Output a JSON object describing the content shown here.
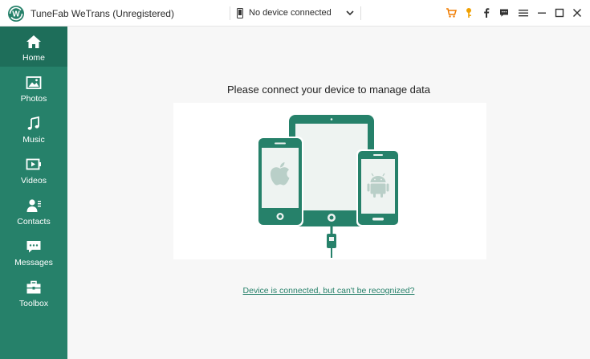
{
  "app": {
    "title": "TuneFab WeTrans (Unregistered)",
    "logo_letter": "W"
  },
  "device_select": {
    "value": "No device connected"
  },
  "toolbar_icons": [
    "cart-icon",
    "key-icon",
    "facebook-icon",
    "feedback-icon",
    "menu-icon",
    "minimize-icon",
    "maximize-icon",
    "close-icon"
  ],
  "sidebar": {
    "items": [
      {
        "label": "Home",
        "icon": "home-icon",
        "active": true
      },
      {
        "label": "Photos",
        "icon": "photos-icon"
      },
      {
        "label": "Music",
        "icon": "music-icon"
      },
      {
        "label": "Videos",
        "icon": "videos-icon"
      },
      {
        "label": "Contacts",
        "icon": "contacts-icon"
      },
      {
        "label": "Messages",
        "icon": "messages-icon"
      },
      {
        "label": "Toolbox",
        "icon": "toolbox-icon"
      }
    ]
  },
  "main": {
    "headline": "Please connect your device to manage data",
    "help_link": "Device is connected, but can't be recognized?"
  },
  "colors": {
    "brand": "#26816a",
    "brand_dark": "#1e6e5a",
    "device_screen": "#eef3f1",
    "cart": "#f07c00",
    "key": "#f0a000"
  }
}
